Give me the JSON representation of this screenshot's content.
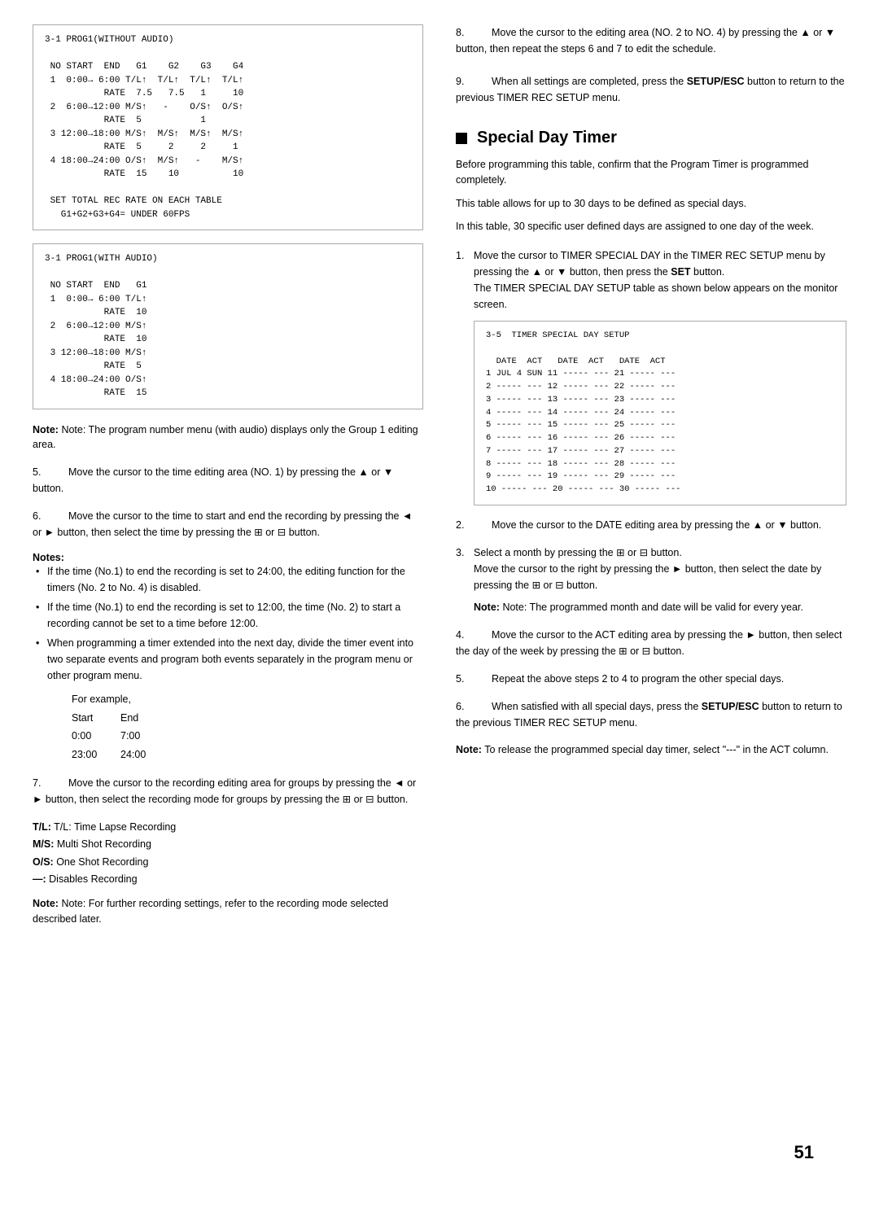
{
  "left": {
    "code_box_1_title": "3-1 PROG1(WITHOUT AUDIO)",
    "code_box_1_content": "3-1 PROG1(WITHOUT AUDIO)\n\n NO START  END   G1    G2    G3    G4\n 1  0:00→ 6:00 T/L↑  T/L↑  T/L↑  T/L↑\n           RATE  7.5   7.5   1     10\n 2  6:00→12:00 M/S↑   -    O/S↑  O/S↑\n           RATE  5           1\n 3 12:00→18:00 M/S↑  M/S↑  M/S↑  M/S↑\n           RATE  5     2     2     1\n 4 18:00→24:00 O/S↑  M/S↑   -    M/S↑\n           RATE  15    10          10\n\n SET TOTAL REC RATE ON EACH TABLE\n   G1+G2+G3+G4= UNDER 60FPS",
    "code_box_2_content": "3-1 PROG1(WITH AUDIO)\n\n NO START  END   G1\n 1  0:00→ 6:00 T/L↑\n           RATE  10\n 2  6:00→12:00 M/S↑\n           RATE  10\n 3 12:00→18:00 M/S↑\n           RATE  5\n 4 18:00→24:00 O/S↑\n           RATE  15",
    "note_program": "Note: The program number menu (with audio) displays only the Group 1 editing area.",
    "item5": "Move the cursor to the time editing area (NO. 1) by pressing the ▲ or ▼ button.",
    "item6": "Move the cursor to the time to start and end the recording by pressing the ◄ or ► button, then select the time by pressing the ⊞ or ⊟ button.",
    "notes_title": "Notes:",
    "note_bullet1": "If the time (No.1) to end the recording is set to 24:00, the editing function for the timers (No. 2 to No. 4) is disabled.",
    "note_bullet2": "If the time (No.1) to end the recording is set to 12:00, the time (No. 2) to start a recording cannot be set to a time before 12:00.",
    "note_bullet3": "When programming a timer extended into the next day, divide the timer event into two separate events and program both events separately in the program menu or other program menu.",
    "example_label": "For example,",
    "example_start_label": "Start",
    "example_end_label": "End",
    "example_row1_start": "0:00",
    "example_row1_end": "7:00",
    "example_row2_start": "23:00",
    "example_row2_end": "24:00",
    "item7": "Move the cursor to the recording editing area for groups by pressing the ◄ or ► button, then select the recording mode for groups by pressing the ⊞ or ⊟ button.",
    "legend_tl": "T/L: Time Lapse Recording",
    "legend_ms": "M/S: Multi Shot Recording",
    "legend_os": "O/S: One Shot Recording",
    "legend_dash": "—: Disables Recording",
    "note_further": "Note: For further recording settings, refer to the recording mode selected described later."
  },
  "right": {
    "section_title": "Special Day Timer",
    "intro1": "Before programming this table, confirm that the Program Timer is programmed completely.",
    "intro2": "This table allows for up to 30 days to be defined as special days.",
    "intro3": "In this table, 30 specific user defined days are assigned to one day of the week.",
    "item1": "Move the cursor to TIMER SPECIAL DAY in the TIMER REC SETUP menu by pressing the ▲ or ▼ button, then press the SET button.",
    "item1b": "The TIMER SPECIAL DAY SETUP table as shown below appears on the monitor screen.",
    "code_box_special_day": "3-5  TIMER SPECIAL DAY SETUP\n\n  DATE  ACT   DATE  ACT   DATE  ACT\n1 JUL 4 SUN 11 ----- --- 21 ----- ---\n2 ----- --- 12 ----- --- 22 ----- ---\n3 ----- --- 13 ----- --- 23 ----- ---\n4 ----- --- 14 ----- --- 24 ----- ---\n5 ----- --- 15 ----- --- 25 ----- ---\n6 ----- --- 16 ----- --- 26 ----- ---\n7 ----- --- 17 ----- --- 27 ----- ---\n8 ----- --- 18 ----- --- 28 ----- ---\n9 ----- --- 19 ----- --- 29 ----- ---\n10 ----- --- 20 ----- --- 30 ----- ---",
    "item2": "Move the cursor to the DATE editing area by pressing the ▲ or ▼ button.",
    "item3a": "Select a month by pressing the ⊞ or ⊟ button.",
    "item3b": "Move the cursor to the right by pressing the ► button, then select the date by pressing the ⊞ or ⊟ button.",
    "note_programmed": "Note: The programmed month and date will be valid for every year.",
    "item4": "Move the cursor to the ACT editing area by pressing the ► button, then select the day of the week by pressing the ⊞ or ⊟ button.",
    "item5": "Repeat the above steps 2 to 4 to program the other special days.",
    "item6": "When satisfied with all special days, press the SETUP/ESC button to return to the previous TIMER REC SETUP menu.",
    "note_release": "Note: To release the programmed special day timer, select \"---\" in the ACT column.",
    "page_number": "51",
    "item8_left": "Move the cursor to the editing area (NO. 2 to NO. 4) by pressing the ▲ or ▼ button, then repeat the steps 6 and 7 to edit the schedule.",
    "item9_left": "When all settings are completed, press the SETUP/ESC button to return to the previous TIMER REC SETUP menu."
  }
}
